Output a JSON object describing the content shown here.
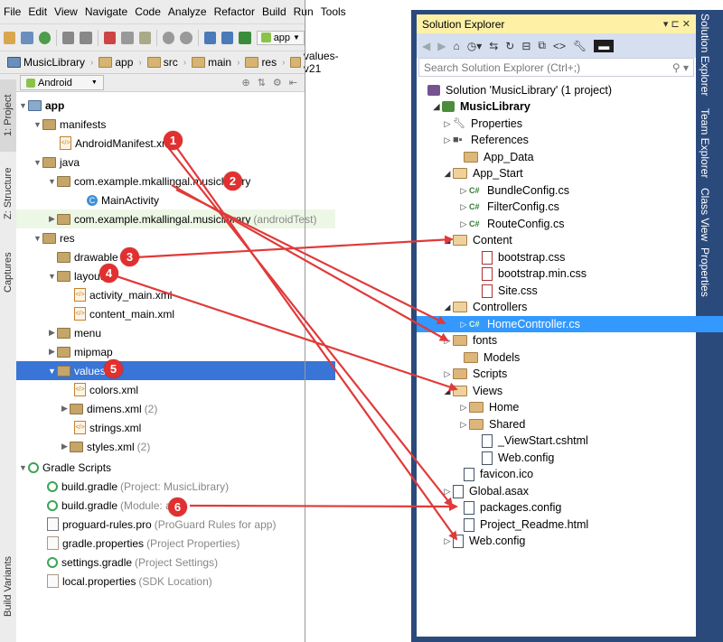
{
  "studio": {
    "menu": [
      "File",
      "Edit",
      "View",
      "Navigate",
      "Code",
      "Analyze",
      "Refactor",
      "Build",
      "Run",
      "Tools"
    ],
    "toolbar_app_label": "app",
    "breadcrumbs": [
      "MusicLibrary",
      "app",
      "src",
      "main",
      "res",
      "values-v21"
    ],
    "view_selector": "Android",
    "side_tabs": {
      "project": "1: Project",
      "structure": "Z: Structure",
      "captures": "Captures",
      "variants": "Build Variants"
    },
    "tree": [
      {
        "label": "app",
        "bold": true
      },
      {
        "label": "manifests"
      },
      {
        "label": "AndroidManifest.xml"
      },
      {
        "label": "java"
      },
      {
        "label": "com.example.mkallingal.musiclibrary"
      },
      {
        "label": "MainActivity"
      },
      {
        "label": "com.example.mkallingal.musiclibrary",
        "note": "(androidTest)"
      },
      {
        "label": "res"
      },
      {
        "label": "drawable"
      },
      {
        "label": "layout"
      },
      {
        "label": "activity_main.xml"
      },
      {
        "label": "content_main.xml"
      },
      {
        "label": "menu"
      },
      {
        "label": "mipmap"
      },
      {
        "label": "values"
      },
      {
        "label": "colors.xml"
      },
      {
        "label": "dimens.xml",
        "note": "(2)"
      },
      {
        "label": "strings.xml"
      },
      {
        "label": "styles.xml",
        "note": "(2)"
      },
      {
        "label": "Gradle Scripts"
      },
      {
        "label": "build.gradle",
        "note": "(Project: MusicLibrary)"
      },
      {
        "label": "build.gradle",
        "note": "(Module: app)"
      },
      {
        "label": "proguard-rules.pro",
        "note": "(ProGuard Rules for app)"
      },
      {
        "label": "gradle.properties",
        "note": "(Project Properties)"
      },
      {
        "label": "settings.gradle",
        "note": "(Project Settings)"
      },
      {
        "label": "local.properties",
        "note": "(SDK Location)"
      }
    ]
  },
  "vs": {
    "title": "Solution Explorer",
    "title_controls": "▾ ⊏ ✕",
    "search_placeholder": "Search Solution Explorer (Ctrl+;)",
    "search_icon": "⚲ ▾",
    "side_tabs": [
      "Solution Explorer",
      "Team Explorer",
      "Class View",
      "Properties"
    ],
    "tree": [
      {
        "label": "Solution 'MusicLibrary' (1 project)"
      },
      {
        "label": "MusicLibrary"
      },
      {
        "label": "Properties"
      },
      {
        "label": "References"
      },
      {
        "label": "App_Data"
      },
      {
        "label": "App_Start"
      },
      {
        "label": "BundleConfig.cs"
      },
      {
        "label": "FilterConfig.cs"
      },
      {
        "label": "RouteConfig.cs"
      },
      {
        "label": "Content"
      },
      {
        "label": "bootstrap.css"
      },
      {
        "label": "bootstrap.min.css"
      },
      {
        "label": "Site.css"
      },
      {
        "label": "Controllers"
      },
      {
        "label": "HomeController.cs"
      },
      {
        "label": "fonts"
      },
      {
        "label": "Models"
      },
      {
        "label": "Scripts"
      },
      {
        "label": "Views"
      },
      {
        "label": "Home"
      },
      {
        "label": "Shared"
      },
      {
        "label": "_ViewStart.cshtml"
      },
      {
        "label": "Web.config"
      },
      {
        "label": "favicon.ico"
      },
      {
        "label": "Global.asax"
      },
      {
        "label": "packages.config"
      },
      {
        "label": "Project_Readme.html"
      },
      {
        "label": "Web.config"
      }
    ]
  },
  "badges": [
    "1",
    "2",
    "3",
    "4",
    "5",
    "6"
  ],
  "colors": {
    "arrow": "#e03a3a",
    "badge": "#e03030",
    "selection_studio": "#3875d7",
    "selection_vs": "#3399ff",
    "vs_frame": "#2b4a7c",
    "vs_title": "#fef1a6"
  }
}
